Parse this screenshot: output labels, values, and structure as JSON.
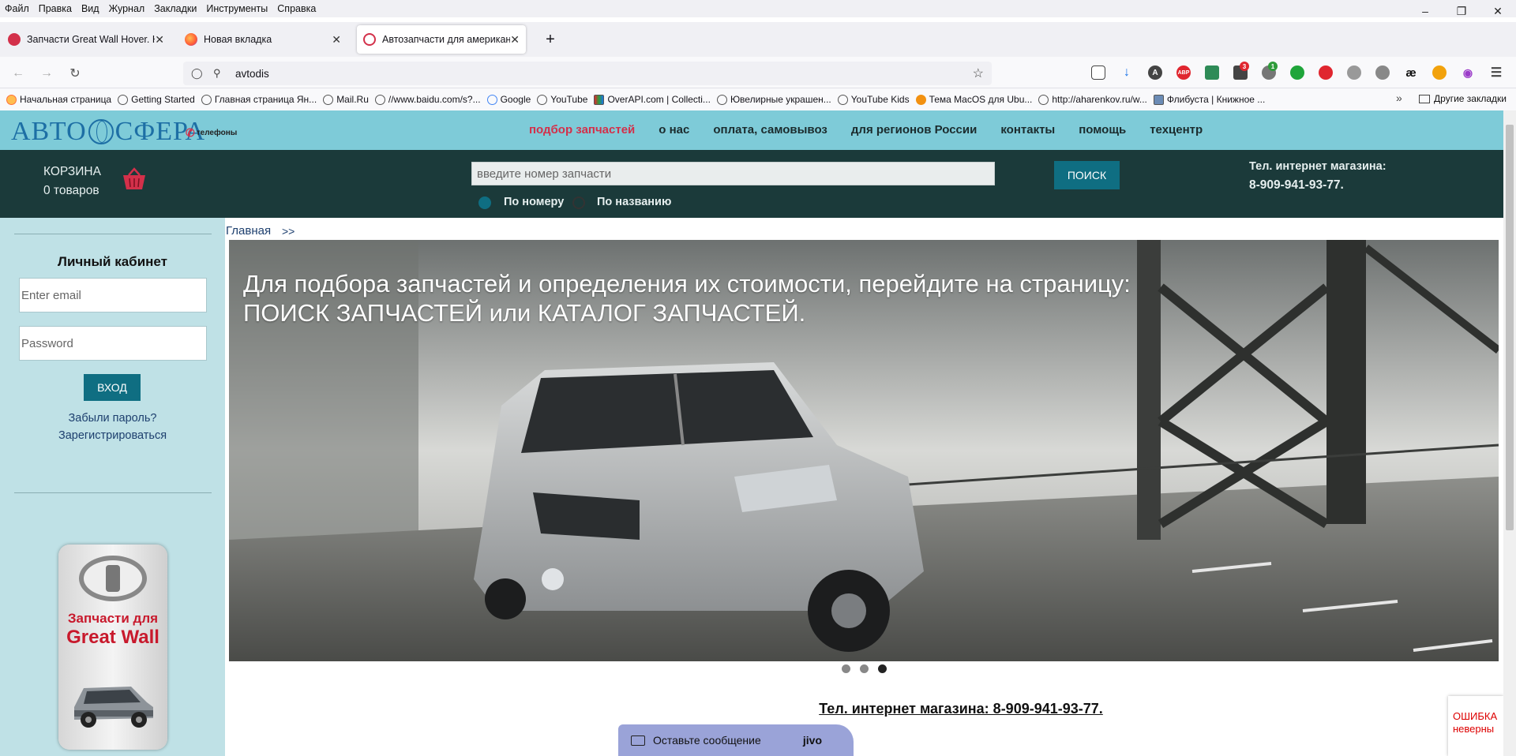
{
  "browser": {
    "menu": [
      "Файл",
      "Правка",
      "Вид",
      "Журнал",
      "Закладки",
      "Инструменты",
      "Справка"
    ],
    "tabs": [
      {
        "title": "Запчасти Great Wall Hover. Ку",
        "active": false
      },
      {
        "title": "Новая вкладка",
        "active": false
      },
      {
        "title": "Автозапчасти для американск",
        "active": true
      }
    ],
    "address": "avtodis",
    "bookmarks": [
      "Начальная страница",
      "Getting Started",
      "Главная страница Ян...",
      "Mail.Ru",
      "//www.baidu.com/s?...",
      "Google",
      "YouTube",
      "OverAPI.com | Collecti...",
      "Ювелирные украшен...",
      "YouTube Kids",
      "Тема MacOS для Ubu...",
      "http://aharenkov.ru/w...",
      "Флибуста | Книжное ..."
    ],
    "other_bookmarks": "Другие закладки",
    "ext_badges": {
      "badge1": "3",
      "badge2": "1"
    }
  },
  "site": {
    "logo": {
      "left": "АВТО",
      "right": "СФЕРА"
    },
    "phones_link": "телефоны",
    "nav": [
      "подбор запчастей",
      "о нас",
      "оплата, самовывоз",
      "для регионов России",
      "контакты",
      "помощь",
      "техцентр"
    ],
    "cart": {
      "label": "КОРЗИНА",
      "count": "0 товаров"
    },
    "search": {
      "placeholder": "введите номер запчасти",
      "button": "ПОИСК",
      "option_number": "По номеру",
      "option_name": "По названию"
    },
    "shop_tel_label": "Тел. интернет магазина:",
    "shop_tel": "8-909-941-93-77.",
    "sidebar": {
      "title": "Личный кабинет",
      "email_placeholder": "Enter email",
      "password_placeholder": "Password",
      "login_button": "ВХОД",
      "forgot": "Забыли пароль?",
      "register": "Зарегистрироваться",
      "banner_l1": "Запчасти для",
      "banner_l2": "Great Wall"
    },
    "breadcrumb": {
      "home": "Главная",
      "sep": ">>"
    },
    "hero": {
      "line1": "Для подбора запчастей и определения их стоимости, перейдите на страницу:",
      "line2": "ПОИСК ЗАПЧАСТЕЙ или КАТАЛОГ ЗАПЧАСТЕЙ."
    },
    "footer_tel": "Тел. интернет магазина: 8-909-941-93-77.",
    "chat": {
      "label": "Оставьте сообщение",
      "brand": "jivo"
    },
    "recaptcha": {
      "l1": "ОШИБКА",
      "l2": "неверны"
    }
  },
  "colors": {
    "header_bg": "#7ecbd8",
    "band_bg": "#1b3a3a",
    "sidebar_bg": "#bfe1e6",
    "accent": "#0f6e82",
    "nav_active": "#d3304a"
  }
}
